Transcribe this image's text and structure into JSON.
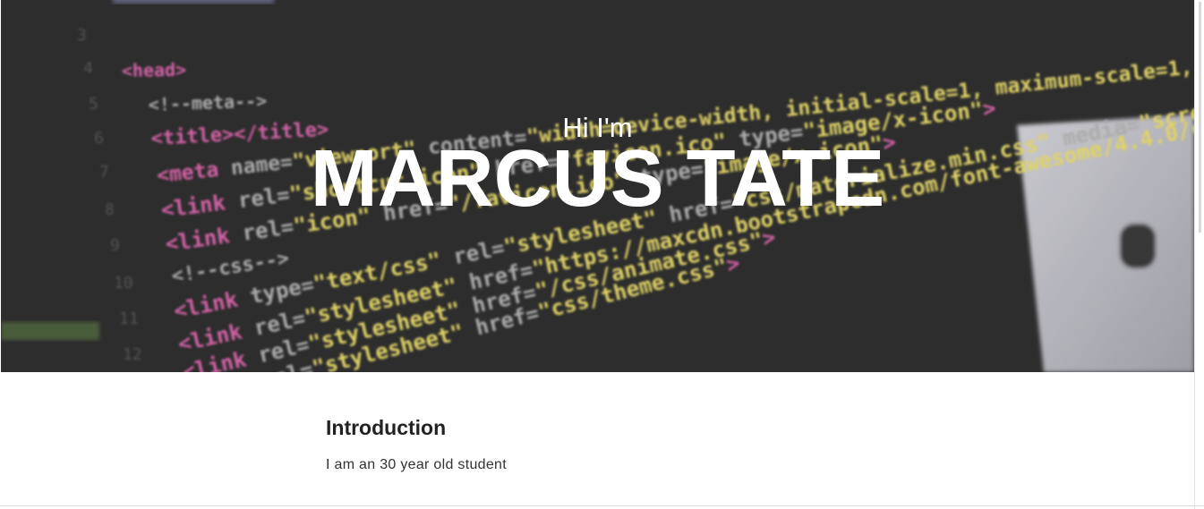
{
  "hero": {
    "greeting": "Hi I'm",
    "name": "MARCUS TATE",
    "code_lines": [
      "<head>",
      "<!--meta-->",
      "<title></title>",
      "<meta name=\"viewport\" content=\"width=device-width, initial-scale=1, maximum-scale=1, user-scalable=no\">",
      "<link rel=\"shortcut icon\" href=\"favicon.ico\" type=\"image/x-icon\">",
      "<link rel=\"icon\" href=\"/favicon.ico\" type=\"image/x-icon\">",
      "<!--css-->",
      "<link type=\"text/css\" rel=\"stylesheet\" href=\"css/materialize.min.css\" media=\"screen,projection\">",
      "<link rel=\"stylesheet\" href=\"https://maxcdn.bootstrapcdn.com/font-awesome/4.4.0/css/font-awesome.min.css\">",
      "<link rel=\"stylesheet\" href=\"/css/animate.css\">",
      "<link rel=\"stylesheet\" href=\"css/theme.css\">"
    ],
    "line_numbers": [
      "3",
      "4",
      "5",
      "6",
      "7",
      "8",
      "9",
      "10",
      "11",
      "12"
    ]
  },
  "intro": {
    "heading": "Introduction",
    "text": "I am an 30 year old student"
  },
  "colors": {
    "hero_bg": "#2e2e2e",
    "tag_pink": "#e36ab2",
    "attr_yellow": "#f0e36e",
    "comment_gray": "#b9b9b9",
    "line_number_gray": "#5a5a5a",
    "heading_text": "#222222",
    "body_text": "#333333"
  }
}
